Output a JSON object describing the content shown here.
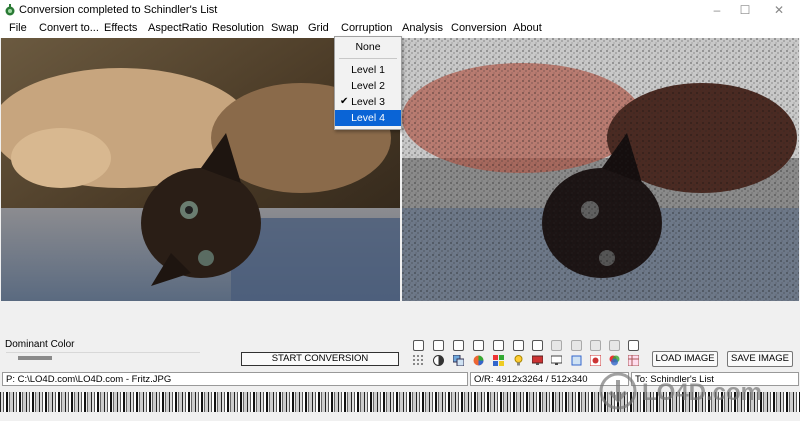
{
  "window": {
    "title": "Conversion completed to Schindler's List",
    "controls": [
      "–",
      "☐",
      "✕"
    ]
  },
  "menu": {
    "items": [
      "File",
      "Convert to...",
      "Effects",
      "AspectRatio",
      "Resolution",
      "Swap",
      "Grid",
      "Corruption",
      "Analysis",
      "Conversion",
      "About"
    ]
  },
  "corruption_menu": {
    "items": [
      "None",
      "Level 1",
      "Level 2",
      "Level 3",
      "Level 4"
    ],
    "checked": "Level 3",
    "highlighted": "Level 4"
  },
  "dominant": {
    "label": "Dominant Color",
    "swatch_color": "#8a8a8a"
  },
  "buttons": {
    "start": "START CONVERSION",
    "load": "LOAD IMAGE",
    "save": "SAVE IMAGE"
  },
  "status": {
    "path": "P:  C:\\LO4D.com\\LO4D.com - Fritz.JPG",
    "dimensions": "O/R:  4912x3264 / 512x340",
    "target": "To:  Schindler's List"
  },
  "watermark": "LO4D.com",
  "icons": [
    "grid-icon",
    "contrast-icon",
    "layers-icon",
    "color-wheel-icon",
    "palette-grid-icon",
    "bulb-icon",
    "monitor-icon",
    "display-icon",
    "frame-icon",
    "color-swap-icon",
    "circles-icon",
    "table-icon"
  ]
}
